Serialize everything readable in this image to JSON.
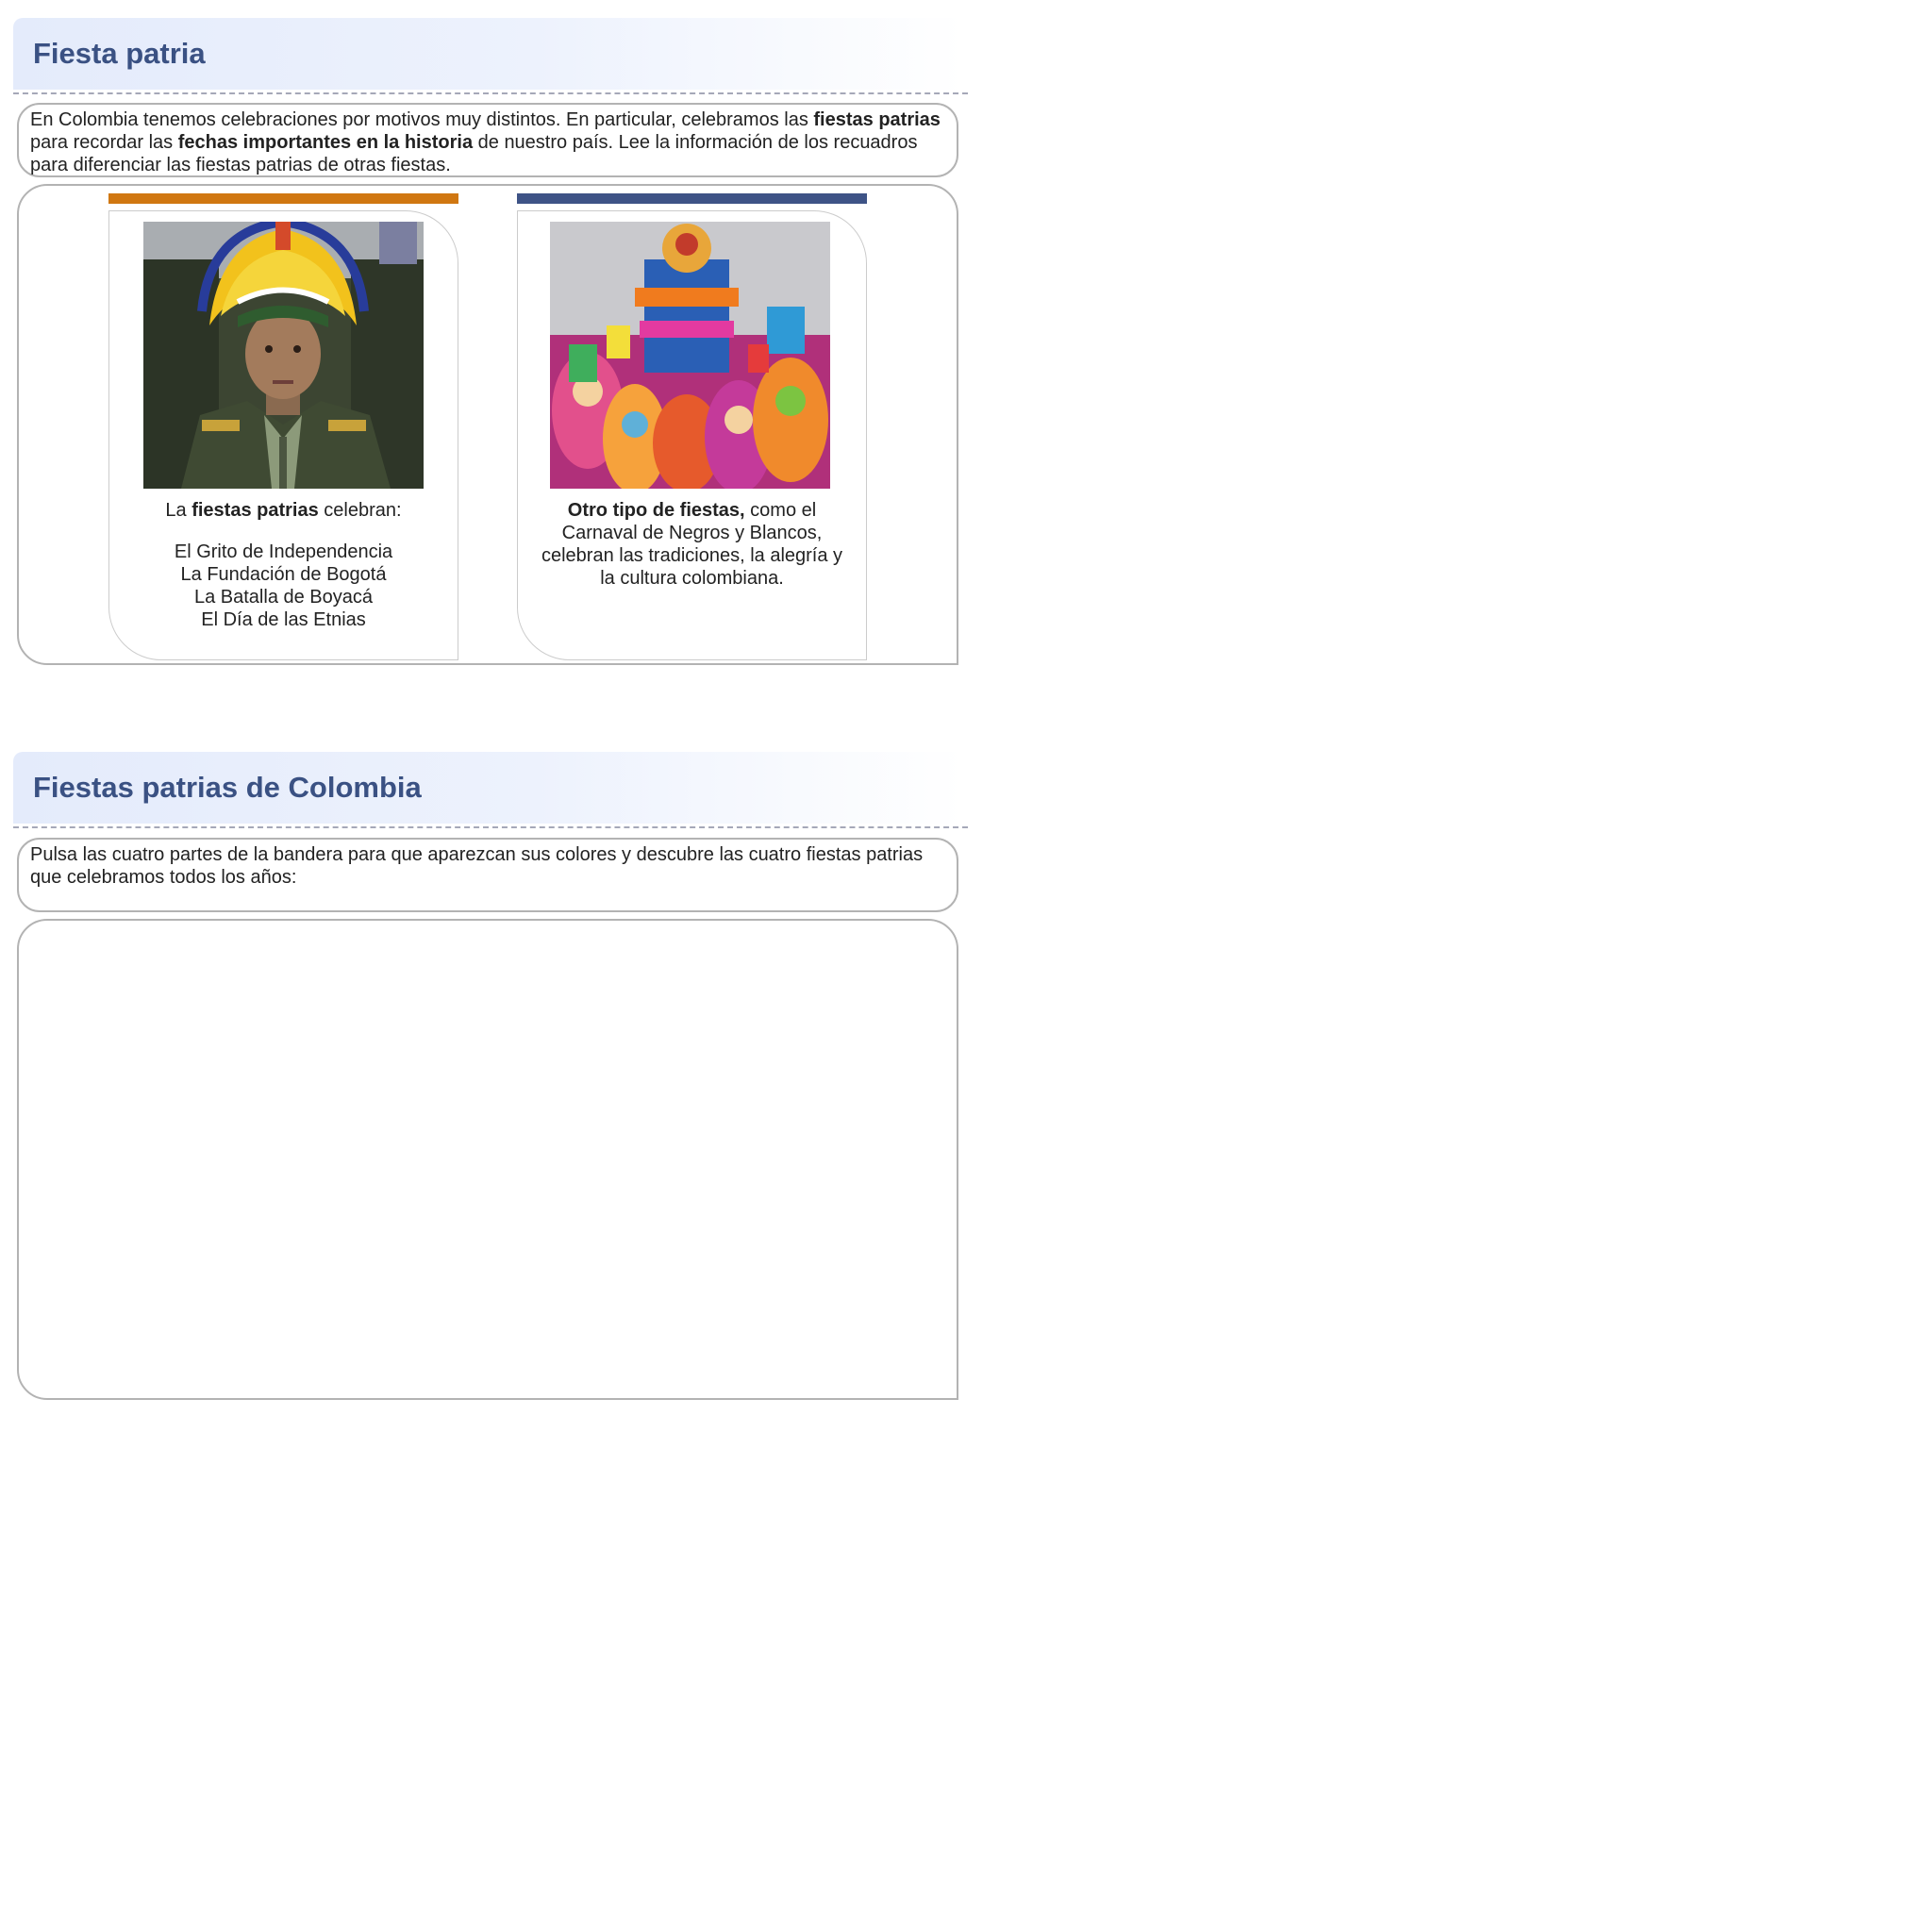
{
  "section1": {
    "title": "Fiesta patria",
    "intro": {
      "t1": "En Colombia tenemos celebraciones por motivos muy distintos. En particular, celebramos las ",
      "b1": "fiestas patrias",
      "t2": " para recordar las ",
      "b2": "fechas importantes en la historia",
      "t3": " de nuestro país. Lee la información de los recuadros para diferenciar las fiestas patrias de otras fiestas."
    },
    "cards": [
      {
        "bar_color": "#d07711",
        "lead_pre": "La ",
        "lead_bold": "fiestas patrias",
        "lead_post": " celebran:",
        "items": [
          "El Grito de Independencia",
          "La Fundación de Bogotá",
          "La Batalla de Boyacá",
          "El Día de las Etnias"
        ]
      },
      {
        "bar_color": "#3e5386",
        "lead_bold": "Otro tipo de fiestas,",
        "lead_post": " como el Carnaval de Negros y Blancos, celebran las tradiciones, la alegría y la cultura colombiana."
      }
    ]
  },
  "section2": {
    "title": "Fiestas patrias de Colombia",
    "instructions": "Pulsa las cuatro partes de la bandera para que aparezcan sus colores y descubre las cuatro fiestas patrias que celebramos todos los años:"
  }
}
